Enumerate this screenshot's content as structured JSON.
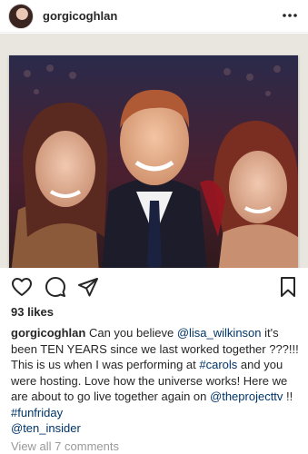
{
  "post": {
    "username": "gorgicoghlan",
    "more_icon": "more-horizontal-icon"
  },
  "actions": {
    "like_icon": "heart-icon",
    "comment_icon": "comment-icon",
    "share_icon": "paper-plane-icon",
    "save_icon": "bookmark-icon"
  },
  "likes": "93 likes",
  "caption": {
    "username": "gorgicoghlan",
    "parts": [
      "Can you believe",
      "@lisa_wilkinson",
      "it's been TEN YEARS since we last worked together ???!!! This is us when I was performing at",
      "#carols",
      "and you were hosting. Love how the universe works! Here we are about to go live together again on",
      "@theprojecttv",
      "!!",
      "#funfriday",
      "@ten_insider"
    ]
  },
  "view_comments": "View all 7 comments",
  "colors": {
    "text": "#262626",
    "link": "#003569",
    "muted": "#999999"
  }
}
